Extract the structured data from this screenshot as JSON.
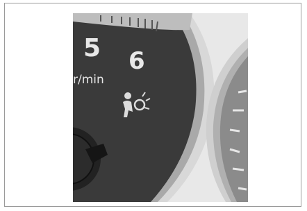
{
  "photo": {
    "tachometer_numbers": [
      "5",
      "6"
    ],
    "unit_label": "r/min",
    "warning_icon": "airbag-warning-icon",
    "colors": {
      "dial_face": "#3b3b3b",
      "numerals": "#e8e8e8",
      "bezel": "#d6d6d6",
      "background_panel": "#e9e9e9"
    }
  }
}
